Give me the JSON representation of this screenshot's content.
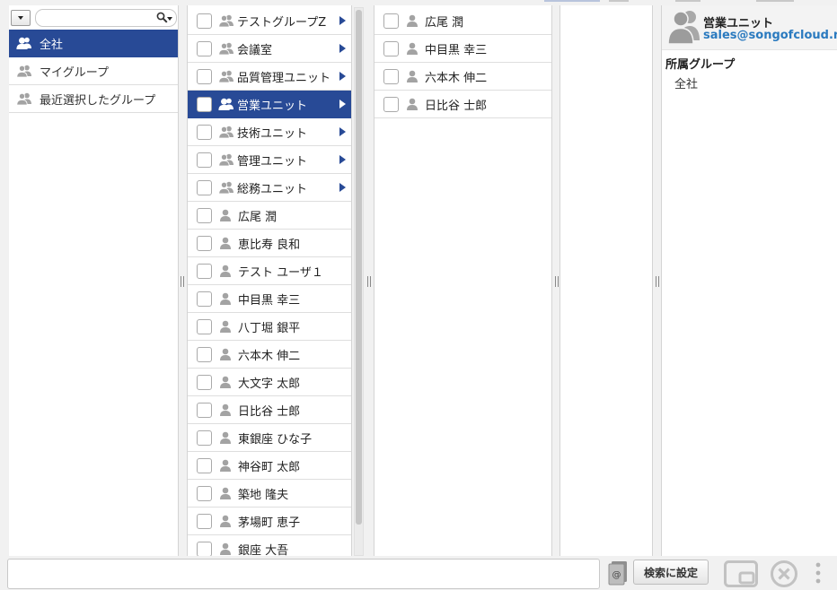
{
  "search": {
    "value": "",
    "placeholder": ""
  },
  "nav": {
    "items": [
      {
        "label": "全社",
        "selected": true
      },
      {
        "label": "マイグループ",
        "selected": false
      },
      {
        "label": "最近選択したグループ",
        "selected": false
      }
    ]
  },
  "members": {
    "groups": [
      {
        "label": "テストグループZ",
        "selected": false
      },
      {
        "label": "会議室",
        "selected": false
      },
      {
        "label": "品質管理ユニット",
        "selected": false
      },
      {
        "label": "営業ユニット",
        "selected": true
      },
      {
        "label": "技術ユニット",
        "selected": false
      },
      {
        "label": "管理ユニット",
        "selected": false
      },
      {
        "label": "総務ユニット",
        "selected": false
      }
    ],
    "users": [
      "広尾 潤",
      "恵比寿 良和",
      "テスト ユーザ１",
      "中目黒 幸三",
      "八丁堀 銀平",
      "六本木 伸二",
      "大文字 太郎",
      "日比谷 士郎",
      "東銀座 ひな子",
      "神谷町 太郎",
      "築地 隆夫",
      "茅場町 恵子",
      "銀座 大吾"
    ]
  },
  "sub_members": {
    "users": [
      "広尾 潤",
      "中目黒 幸三",
      "六本木 伸二",
      "日比谷 士郎"
    ]
  },
  "detail": {
    "name": "営業ユニット",
    "email": "sales@songofcloud.net",
    "group_section_title": "所属グループ",
    "groups": [
      "全社"
    ]
  },
  "footer": {
    "set_button_label": "検索に設定",
    "input_value": ""
  },
  "icons": {
    "dropdown": "chevron-down-icon",
    "search": "search-icon",
    "group": "group-icon",
    "user": "user-icon",
    "submenu": "chevron-right-icon",
    "address_book": "address-book-icon",
    "layout": "window-layout-icon",
    "close": "close-circle-icon",
    "more": "more-vertical-icon"
  },
  "colors": {
    "selection": "#284a96",
    "link": "#2a7abf",
    "icon_gray": "#a3a3a3"
  }
}
